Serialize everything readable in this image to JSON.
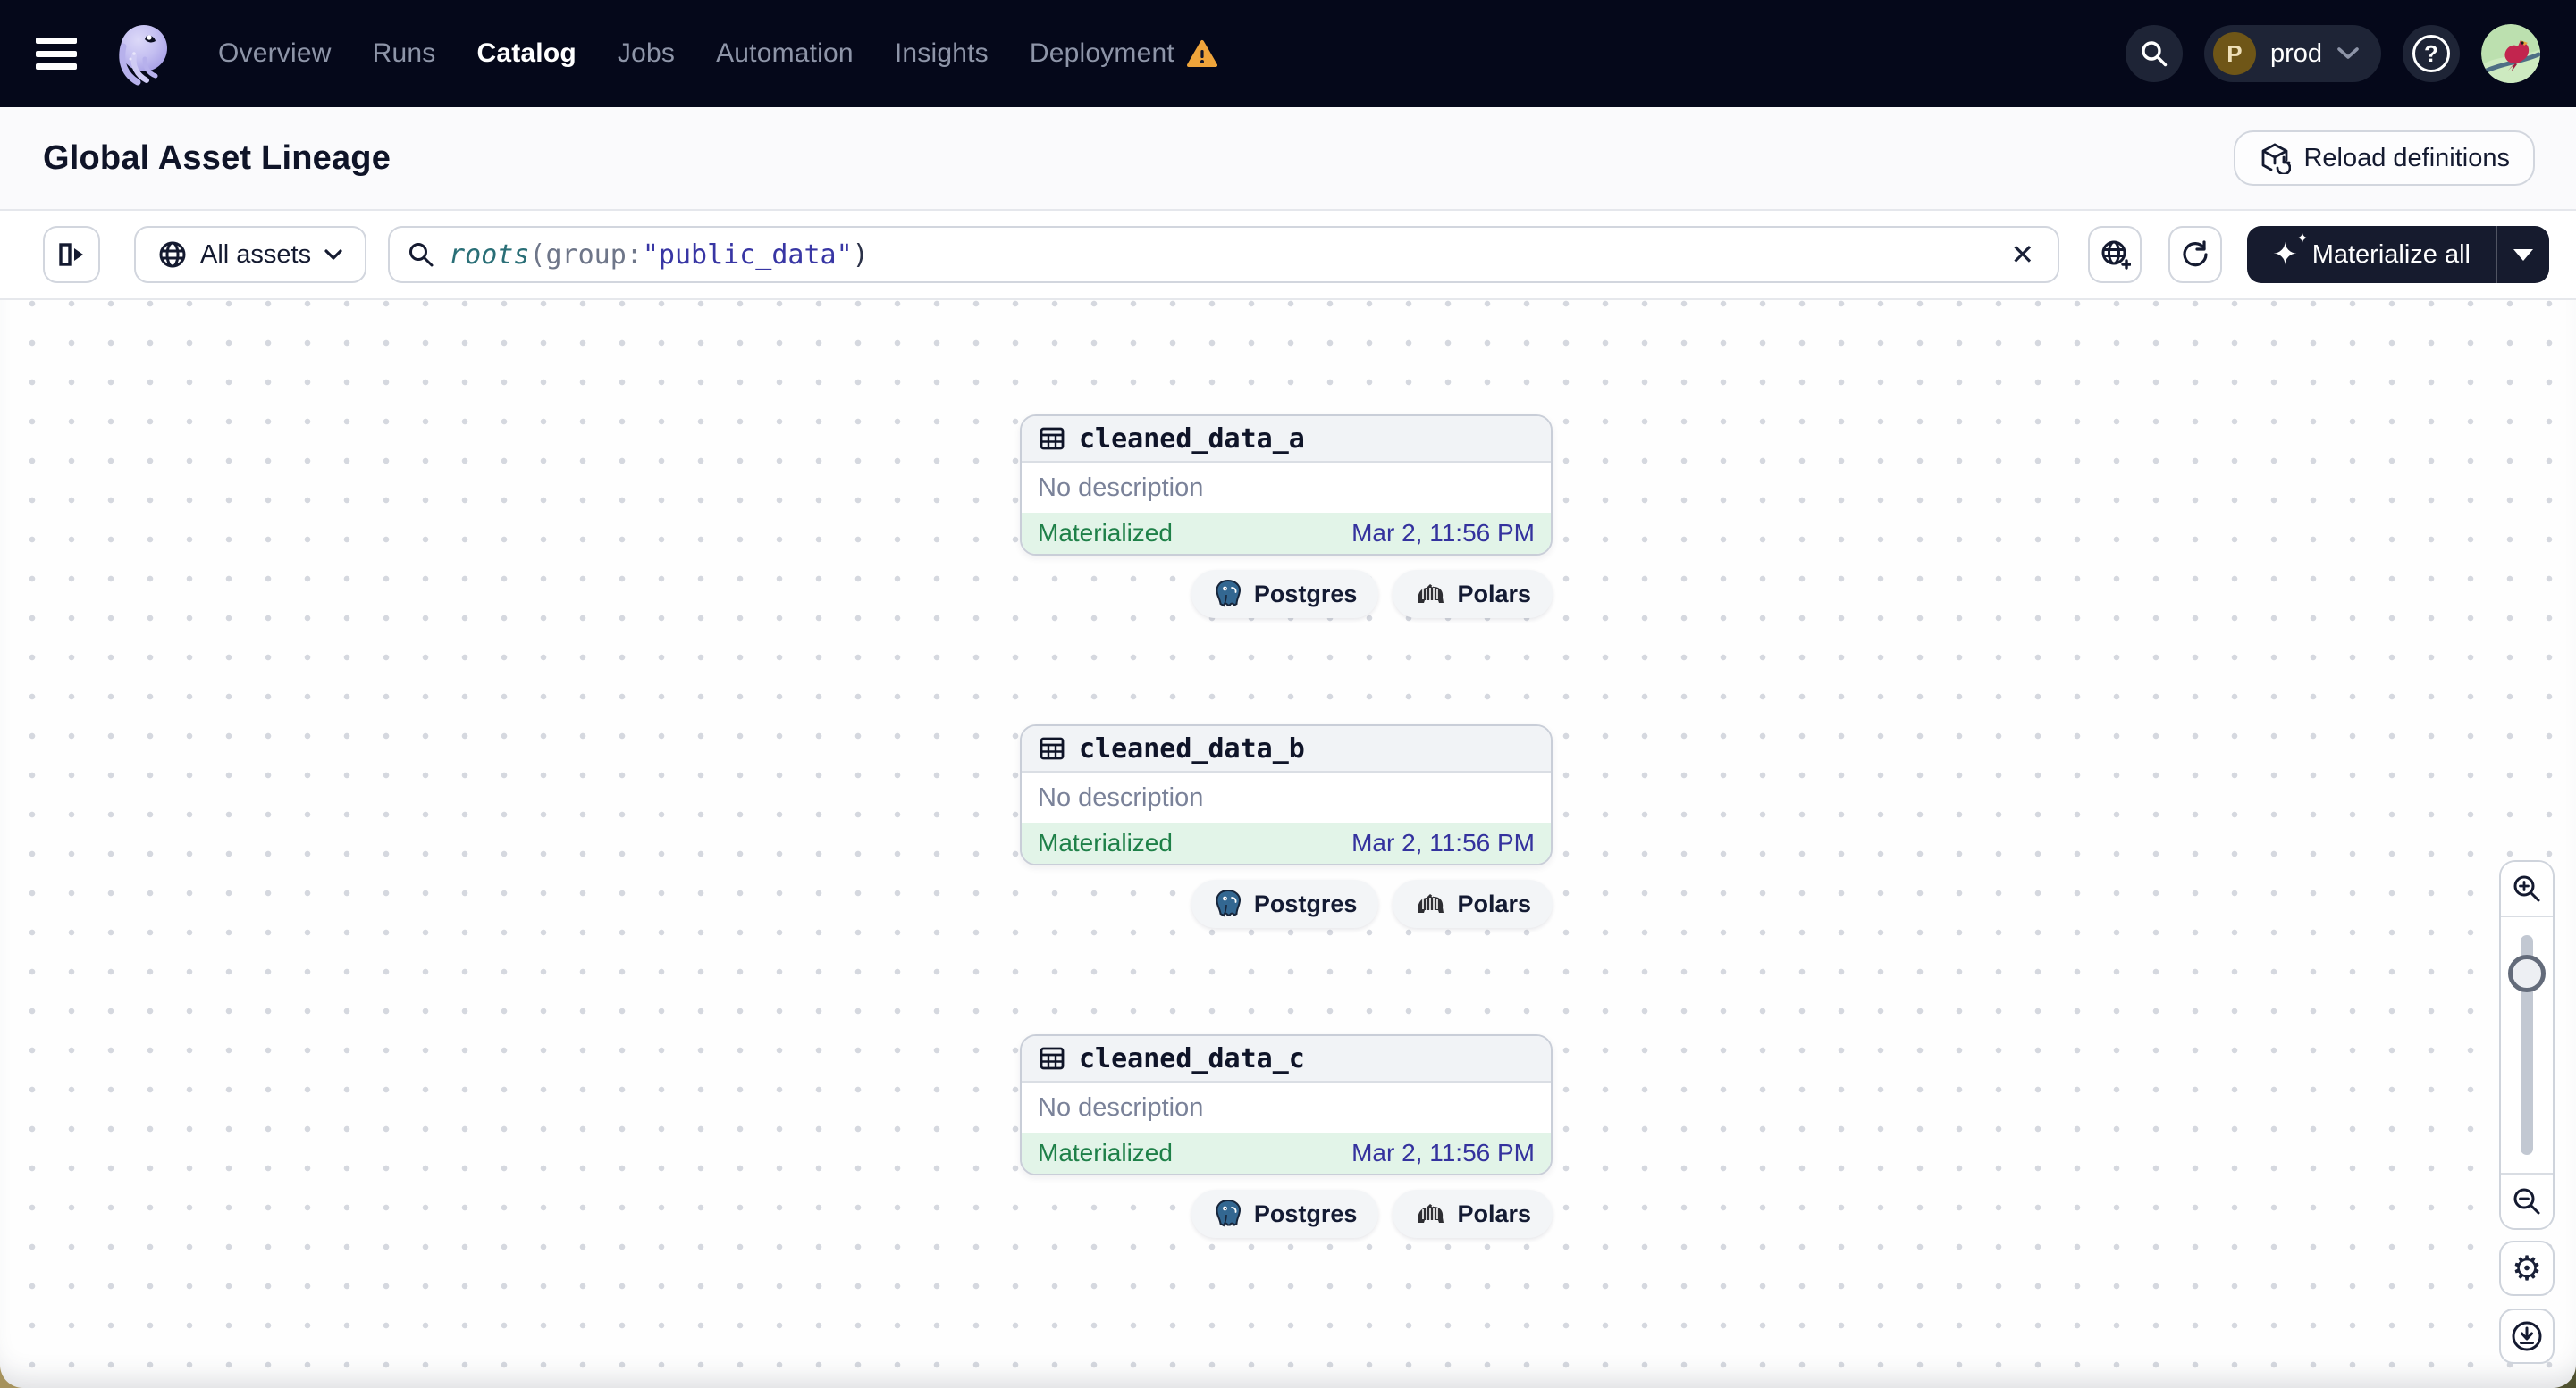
{
  "nav": {
    "items": [
      {
        "label": "Overview",
        "active": false
      },
      {
        "label": "Runs",
        "active": false
      },
      {
        "label": "Catalog",
        "active": true
      },
      {
        "label": "Jobs",
        "active": false
      },
      {
        "label": "Automation",
        "active": false
      },
      {
        "label": "Insights",
        "active": false
      },
      {
        "label": "Deployment",
        "active": false,
        "warning": true
      }
    ],
    "environment": {
      "initial": "P",
      "label": "prod"
    }
  },
  "header": {
    "title": "Global Asset Lineage",
    "reload_label": "Reload definitions"
  },
  "toolbar": {
    "scope_label": "All assets",
    "query": {
      "func": "roots",
      "open": "(",
      "key": "group",
      "colon": ":",
      "value": "\"public_data\"",
      "close": ")"
    },
    "materialize_label": "Materialize all"
  },
  "canvas": {
    "nodes": [
      {
        "name": "cleaned_data_a",
        "description": "No description",
        "status": "Materialized",
        "materialized_at": "Mar 2, 11:56 PM",
        "tags": [
          "Postgres",
          "Polars"
        ]
      },
      {
        "name": "cleaned_data_b",
        "description": "No description",
        "status": "Materialized",
        "materialized_at": "Mar 2, 11:56 PM",
        "tags": [
          "Postgres",
          "Polars"
        ]
      },
      {
        "name": "cleaned_data_c",
        "description": "No description",
        "status": "Materialized",
        "materialized_at": "Mar 2, 11:56 PM",
        "tags": [
          "Postgres",
          "Polars"
        ]
      }
    ]
  },
  "icons": {
    "clear": "✕",
    "sparkle_large": "✦",
    "sparkle_small": "✦",
    "gear": "⚙",
    "question": "?"
  },
  "colors": {
    "nav_bg": "#05081A",
    "accent_dark": "#161B2E",
    "status_green": "#1E8048",
    "timestamp_indigo": "#34329E",
    "warning_orange": "#EFA43B",
    "query_func_teal": "#2A6F77",
    "query_value_indigo": "#3836A4",
    "materialized_bg": "#E2F4E8"
  }
}
